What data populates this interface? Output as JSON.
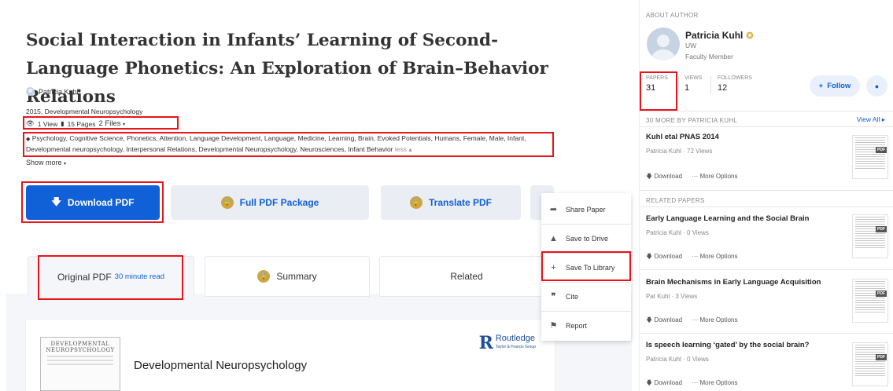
{
  "paper": {
    "title": "Social Interaction in Infants’ Learning of Second-Language Phonetics: An Exploration of Brain–Behavior Relations",
    "author": "Patricia Kuhl",
    "pub_info": "2015, Developmental Neuropsychology",
    "views": "1 View",
    "pages": "15 Pages",
    "files": "2 Files",
    "tags": "Psychology, Cognitive Science, Phonetics, Attention, Language Development, Language, Medicine, Learning, Brain, Evoked Potentials, Humans, Female, Male, Infant, Developmental neuropsychology, Interpersonal Relations, Developmental Neuropsychology, Neurosciences, Infant Behavior",
    "tags_less": "less",
    "show_more": "Show more"
  },
  "actions": {
    "download": "Download PDF",
    "full_package": "Full PDF Package",
    "translate": "Translate PDF"
  },
  "menu": [
    {
      "icon": "share-icon",
      "label": "Share Paper"
    },
    {
      "icon": "drive-icon",
      "label": "Save to Drive"
    },
    {
      "icon": "plus-icon",
      "label": "Save To Library"
    },
    {
      "icon": "quote-icon",
      "label": "Cite"
    },
    {
      "icon": "flag-icon",
      "label": "Report"
    }
  ],
  "tabs": {
    "original": "Original PDF",
    "original_sub": "30 minute read",
    "summary": "Summary",
    "related": "Related"
  },
  "preview": {
    "journal_cover": "DEVELOPMENTAL NEUROPSYCHOLOGY",
    "journal_name": "Developmental Neuropsychology",
    "publisher": "Routledge",
    "publisher_sub": "Taylor & Francis Group"
  },
  "sidebar": {
    "about_label": "ABOUT AUTHOR",
    "author_name": "Patricia Kuhl",
    "institution": "UW",
    "role": "Faculty Member",
    "stats": [
      {
        "label": "PAPERS",
        "value": "31"
      },
      {
        "label": "VIEWS",
        "value": "1"
      },
      {
        "label": "FOLLOWERS",
        "value": "12"
      }
    ],
    "follow": "Follow",
    "more_by": "30 MORE BY PATRICIA KUHL",
    "view_all": "View All",
    "related_label": "RELATED PAPERS",
    "download_label": "Download",
    "more_options": "More Options",
    "more_papers": [
      {
        "title": "Kuhl etal PNAS 2014",
        "meta": "Patricia Kuhl · 72 Views"
      }
    ],
    "related_papers": [
      {
        "title": "Early Language Learning and the Social Brain",
        "meta": "Patricia Kuhl · 0 Views"
      },
      {
        "title": "Brain Mechanisms in Early Language Acquisition",
        "meta": "Pat Kuhl · 3 Views"
      },
      {
        "title": "Is speech learning ‘gated’ by the social brain?",
        "meta": "Patricia Kuhl · 0 Views"
      }
    ]
  },
  "colors": {
    "accent": "#1060d8",
    "highlight": "#e8141c",
    "lock": "#c9a64b"
  }
}
